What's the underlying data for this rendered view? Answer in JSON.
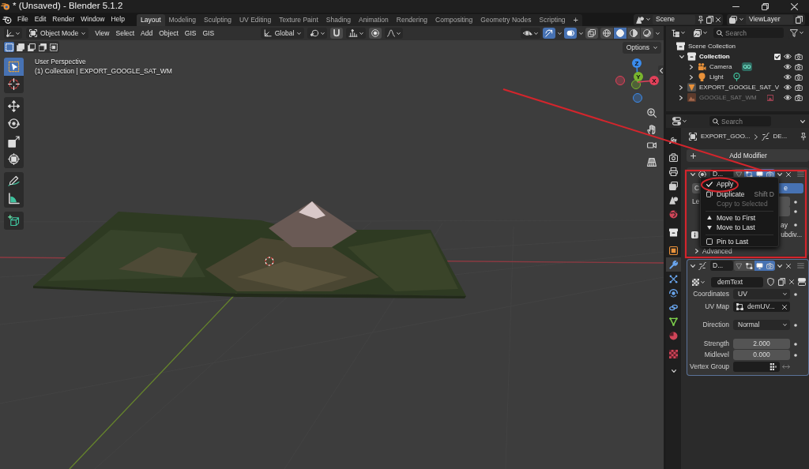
{
  "window": {
    "title": "* (Unsaved) - Blender 5.1.2",
    "controls": [
      {
        "kind": "minimize"
      },
      {
        "kind": "restore"
      },
      {
        "kind": "close"
      }
    ]
  },
  "menu": [
    "File",
    "Edit",
    "Render",
    "Window",
    "Help"
  ],
  "workspaces": [
    {
      "label": "Layout",
      "selected": true
    },
    {
      "label": "Modeling",
      "selected": false
    },
    {
      "label": "Sculpting",
      "selected": false
    },
    {
      "label": "UV Editing",
      "selected": false
    },
    {
      "label": "Texture Paint",
      "selected": false
    },
    {
      "label": "Shading",
      "selected": false
    },
    {
      "label": "Animation",
      "selected": false
    },
    {
      "label": "Rendering",
      "selected": false
    },
    {
      "label": "Compositing",
      "selected": false
    },
    {
      "label": "Geometry Nodes",
      "selected": false
    },
    {
      "label": "Scripting",
      "selected": false
    }
  ],
  "add_workspace": "+",
  "scene": "Scene",
  "view_layer": "ViewLayer",
  "viewport": {
    "mode": "Object Mode",
    "menus": [
      "View",
      "Select",
      "Add",
      "Object",
      "GIS",
      "GIS"
    ],
    "orientation": "Global",
    "toggles": [
      {
        "kind": "snap",
        "on": false
      },
      {
        "kind": "proportional",
        "on": false
      },
      {
        "kind": "gizmos",
        "on": true
      },
      {
        "kind": "overlays",
        "on": true
      },
      {
        "kind": "xray",
        "on": false
      }
    ],
    "shading": [
      {
        "kind": "wireframe",
        "selected": false
      },
      {
        "kind": "solid",
        "selected": true
      },
      {
        "kind": "material",
        "selected": false
      },
      {
        "kind": "rendered",
        "selected": false
      }
    ],
    "select_modes": [
      {
        "kind": "set",
        "selected": true
      },
      {
        "kind": "extend",
        "selected": false
      },
      {
        "kind": "subtract",
        "selected": false
      },
      {
        "kind": "invert",
        "selected": false
      },
      {
        "kind": "intersect",
        "selected": false
      }
    ],
    "tool_groups": [
      {
        "tools": [
          {
            "kind": "select",
            "selected": true
          },
          {
            "kind": "cursor",
            "selected": false
          }
        ]
      },
      {
        "tools": [
          {
            "kind": "move",
            "selected": false
          },
          {
            "kind": "rotate",
            "selected": false
          },
          {
            "kind": "scale",
            "selected": false
          },
          {
            "kind": "transform",
            "selected": false
          }
        ]
      },
      {
        "tools": [
          {
            "kind": "annotate",
            "selected": false
          },
          {
            "kind": "measure",
            "selected": false
          }
        ]
      },
      {
        "tools": [
          {
            "kind": "add_cube",
            "selected": false
          }
        ]
      }
    ],
    "perspective": "User Perspective",
    "context": "(1) Collection | EXPORT_GOOGLE_SAT_WM",
    "options": "Options",
    "gizmo": [
      {
        "label": "Z",
        "color": "#3b8ced",
        "negative_shown": true
      },
      {
        "label": "Y",
        "color": "#79b52e",
        "negative_shown": true
      },
      {
        "label": "X",
        "color": "#e2415a",
        "negative_shown": true
      }
    ],
    "nav": [
      {
        "kind": "zoom"
      },
      {
        "kind": "pan"
      },
      {
        "kind": "camera"
      },
      {
        "kind": "projection"
      }
    ]
  },
  "outliner": {
    "search": {
      "placeholder": "Search"
    },
    "tree": [
      {
        "label": "Scene Collection",
        "kind": "scene",
        "active": false,
        "dimmed": false,
        "children": [
          {
            "label": "Collection",
            "kind": "collection",
            "expanded": true,
            "active": true,
            "dimmed": false,
            "checked": true,
            "children": [
              {
                "label": "Camera",
                "kind": "camera",
                "expanded": false,
                "active": false,
                "dimmed": false
              },
              {
                "label": "Light",
                "kind": "light",
                "expanded": false,
                "active": false,
                "dimmed": false
              }
            ]
          },
          {
            "label": "EXPORT_GOOGLE_SAT_V",
            "kind": "mesh",
            "expanded": false,
            "active": false,
            "dimmed": false
          },
          {
            "label": "GOOGLE_SAT_WM",
            "kind": "image",
            "expanded": false,
            "active": false,
            "dimmed": true
          }
        ]
      }
    ]
  },
  "properties": {
    "search": {
      "placeholder": "Search"
    },
    "tabs": [
      {
        "kind": "tool",
        "selected": false
      },
      {
        "kind": "render",
        "selected": false
      },
      {
        "kind": "output",
        "selected": false
      },
      {
        "kind": "view_layer",
        "selected": false
      },
      {
        "kind": "scene",
        "selected": false
      },
      {
        "kind": "world",
        "selected": false
      },
      {
        "kind": "collection",
        "selected": false
      },
      {
        "kind": "object",
        "selected": false
      },
      {
        "kind": "modifiers",
        "selected": true
      },
      {
        "kind": "particles",
        "selected": false
      },
      {
        "kind": "physics",
        "selected": false
      },
      {
        "kind": "constraints",
        "selected": false
      },
      {
        "kind": "data",
        "selected": false
      },
      {
        "kind": "material",
        "selected": false
      },
      {
        "kind": "texture",
        "selected": false
      }
    ],
    "breadcrumb": [
      "EXPORT_GOO...",
      "DE..."
    ],
    "add_modifier": "Add Modifier",
    "modifiers": [
      {
        "kind": "subdivision",
        "name": "D...",
        "expanded": true,
        "active": false,
        "toggles": [
          {
            "kind": "cage",
            "on": false
          },
          {
            "kind": "editmode",
            "on": true
          },
          {
            "kind": "realtime",
            "on": true
          },
          {
            "kind": "render",
            "on": true
          }
        ],
        "rows": [
          {
            "kind": "toggle_pair",
            "options": [
              {
                "label": "C",
                "selected": false
              },
              {
                "label": "e",
                "selected": true
              }
            ]
          },
          {
            "kind": "field",
            "label": "Le",
            "animatable": true
          },
          {
            "kind": "field",
            "animatable": true
          },
          {
            "kind": "dot_label",
            "label": "ay",
            "animatable": true
          },
          {
            "kind": "info",
            "text": "ubdiv..."
          },
          {
            "kind": "subpanel",
            "label": "Advanced",
            "expanded": false
          }
        ]
      },
      {
        "kind": "displace",
        "name": "D...",
        "expanded": true,
        "active": true,
        "toggles": [
          {
            "kind": "cage",
            "on": false
          },
          {
            "kind": "editmode",
            "on": false
          },
          {
            "kind": "realtime",
            "on": true
          },
          {
            "kind": "render",
            "on": true
          }
        ],
        "rows": [
          {
            "kind": "texture",
            "value": "demText"
          },
          {
            "kind": "dropdown",
            "label": "Coordinates",
            "value": "UV",
            "animatable": true
          },
          {
            "kind": "search",
            "label": "UV Map",
            "value": "demUV...",
            "animatable": false
          },
          {
            "kind": "dropdown",
            "label": "Direction",
            "value": "Normal",
            "animatable": true
          },
          {
            "kind": "number",
            "label": "Strength",
            "value": "2.000",
            "animatable": true
          },
          {
            "kind": "number",
            "label": "Midlevel",
            "value": "0.000",
            "animatable": true
          },
          {
            "kind": "vertex_group",
            "label": "Vertex Group",
            "animatable": false
          }
        ]
      }
    ],
    "context_menu": {
      "items": [
        {
          "kind": "apply",
          "label": "Apply",
          "disabled": false
        },
        {
          "kind": "duplicate",
          "label": "Duplicate",
          "shortcut": "Shift D",
          "disabled": false
        },
        {
          "kind": "copy",
          "label": "Copy to Selected",
          "disabled": true
        },
        {
          "kind": "separator"
        },
        {
          "kind": "move_first",
          "label": "Move to First",
          "disabled": false
        },
        {
          "kind": "move_last",
          "label": "Move to Last",
          "disabled": false
        },
        {
          "kind": "separator"
        },
        {
          "kind": "pin",
          "label": "Pin to Last",
          "disabled": false,
          "checked": false
        }
      ]
    }
  },
  "annotations": [
    {
      "kind": "line"
    },
    {
      "kind": "frame"
    },
    {
      "kind": "ellipse"
    }
  ]
}
